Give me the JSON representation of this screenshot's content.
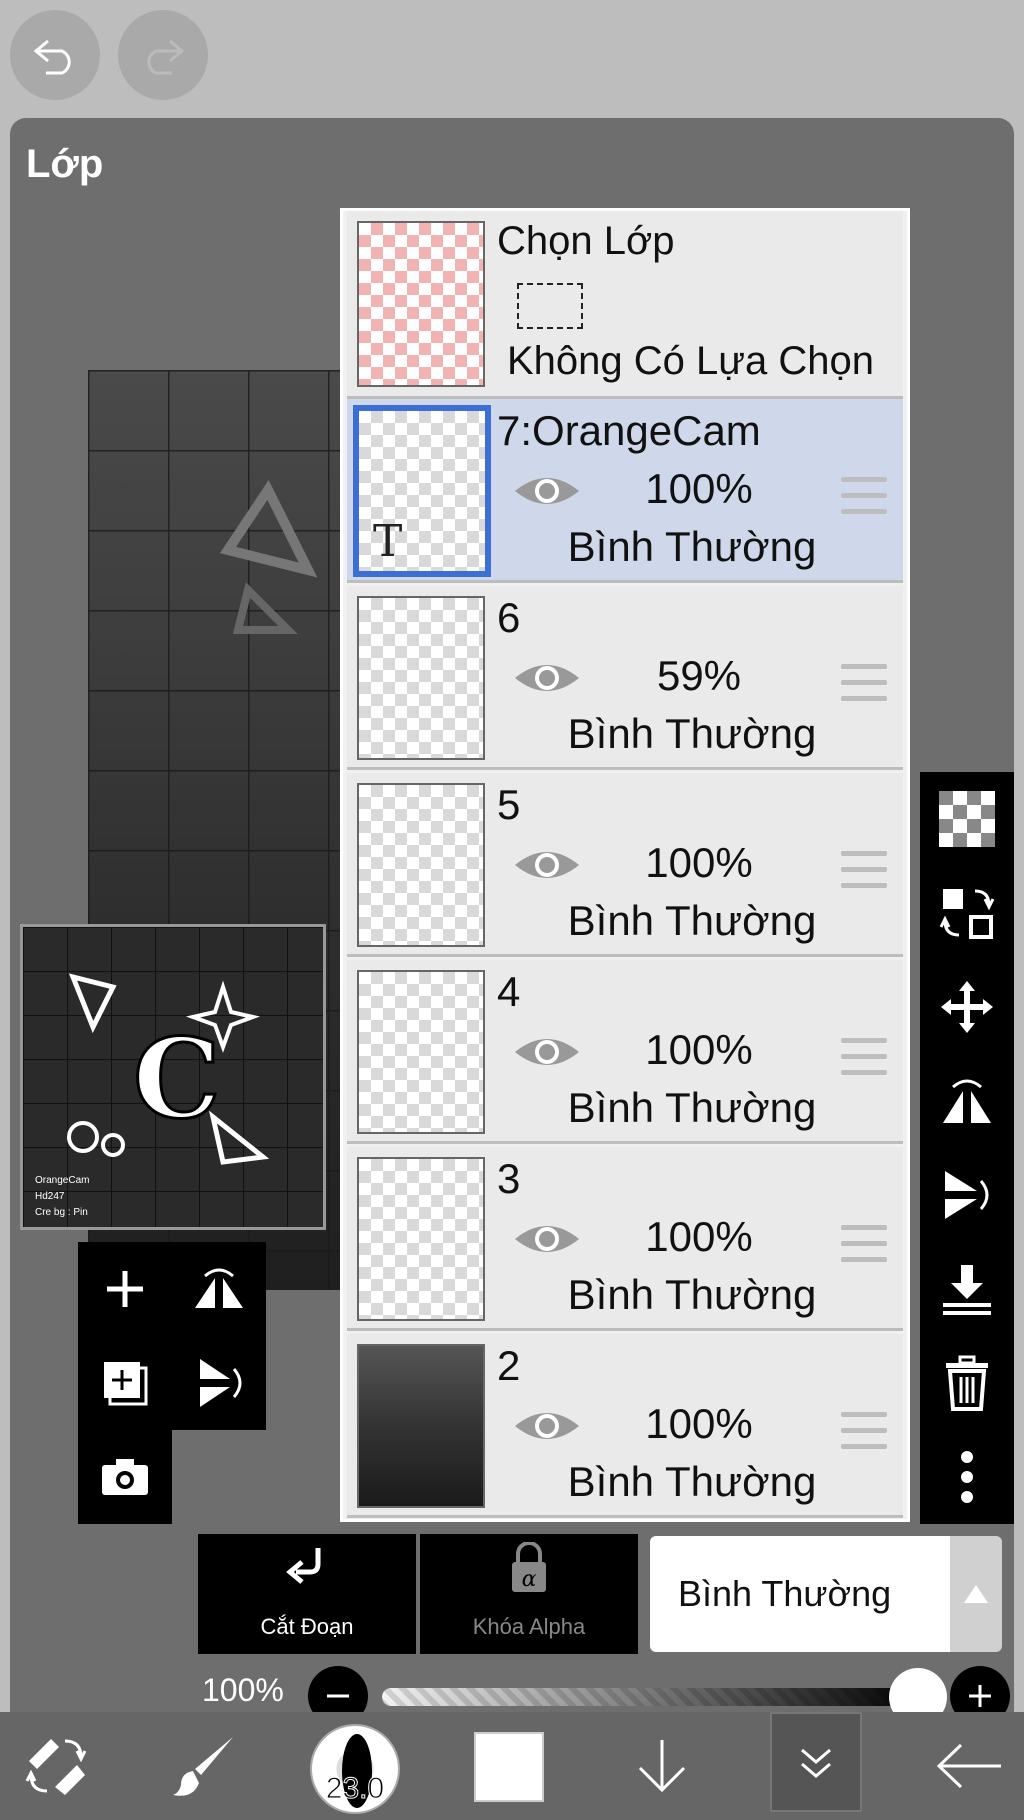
{
  "panel": {
    "title": "Lớp"
  },
  "selection_row": {
    "title": "Chọn Lớp",
    "description": "Không Có Lựa Chọn"
  },
  "layers": [
    {
      "name": "7:OrangeCam",
      "opacity": "100%",
      "mode": "Bình Thường",
      "selected": true,
      "has_text_icon": true
    },
    {
      "name": "6",
      "opacity": "59%",
      "mode": "Bình Thường",
      "selected": false
    },
    {
      "name": "5",
      "opacity": "100%",
      "mode": "Bình Thường",
      "selected": false
    },
    {
      "name": "4",
      "opacity": "100%",
      "mode": "Bình Thường",
      "selected": false
    },
    {
      "name": "3",
      "opacity": "100%",
      "mode": "Bình Thường",
      "selected": false
    },
    {
      "name": "2",
      "opacity": "100%",
      "mode": "Bình Thường",
      "selected": false
    }
  ],
  "text_layer_icon": "T",
  "thumbnail_text": [
    "OrangeCam",
    "Hd247",
    "Cre bg : Pin"
  ],
  "bottom_bar": {
    "clip_label": "Cắt Đoạn",
    "alpha_lock_label": "Khóa Alpha",
    "blend_mode": "Bình Thường",
    "opacity_label": "100%",
    "opacity_value": 1.0
  },
  "toolbar": {
    "brush_size": "23.0",
    "color": "#ffffff"
  },
  "colors": {
    "selected_layer_bg": "#cfd8ea",
    "selected_border": "#3b6fd4",
    "panel_bg": "#6e6e6e"
  }
}
